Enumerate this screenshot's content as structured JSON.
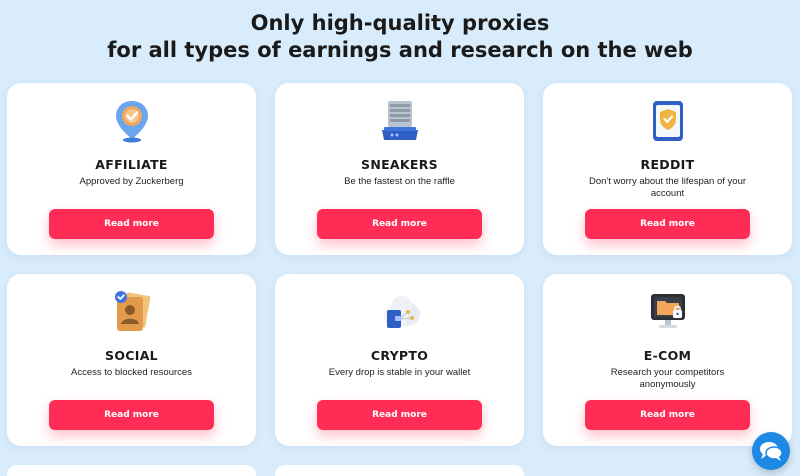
{
  "header": {
    "line1": "Only high-quality proxies",
    "line2": "for all types of earnings and research on the web"
  },
  "cards": [
    {
      "title": "AFFILIATE",
      "description": "Approved by Zuckerberg",
      "button": "Read more",
      "icon": "location-check-icon"
    },
    {
      "title": "SNEAKERS",
      "description": "Be the fastest on the raffle",
      "button": "Read more",
      "icon": "server-icon"
    },
    {
      "title": "REDDIT",
      "description": "Don't worry about the lifespan of your account",
      "button": "Read more",
      "icon": "phone-shield-icon"
    },
    {
      "title": "SOCIAL",
      "description": "Access to blocked resources",
      "button": "Read more",
      "icon": "profile-document-icon"
    },
    {
      "title": "CRYPTO",
      "description": "Every drop is stable in your wallet",
      "button": "Read more",
      "icon": "cloud-wallet-icon"
    },
    {
      "title": "E-COM",
      "description": "Research your competitors anonymously",
      "button": "Read more",
      "icon": "monitor-lock-icon"
    }
  ],
  "chat": {
    "icon": "chat-bubble-icon"
  },
  "colors": {
    "background": "#d8ecfb",
    "accent": "#ff2d55",
    "chat": "#1e88e5"
  }
}
